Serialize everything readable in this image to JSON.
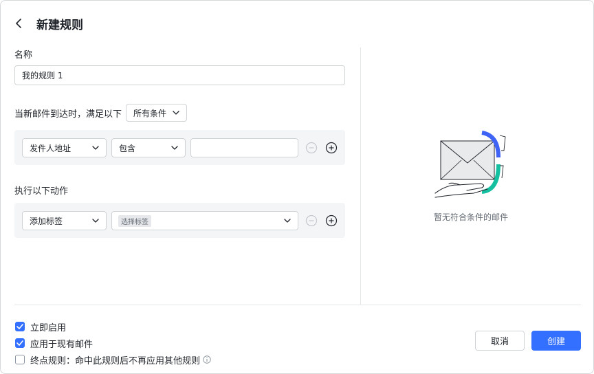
{
  "header": {
    "title": "新建规则"
  },
  "form": {
    "name_label": "名称",
    "name_value": "我的规则 1",
    "condition_prefix": "当新邮件到达时，满足以下",
    "condition_mode": "所有条件",
    "condition_rule": {
      "field": "发件人地址",
      "operator": "包含",
      "value": ""
    },
    "action_label": "执行以下动作",
    "action_rule": {
      "action": "添加标签",
      "tag_placeholder": "选择标签"
    }
  },
  "preview": {
    "empty_text": "暂无符合条件的邮件"
  },
  "options": [
    {
      "label": "立即启用",
      "checked": true
    },
    {
      "label": "应用于现有邮件",
      "checked": true
    },
    {
      "label": "终点规则：命中此规则后不再应用其他规则",
      "checked": false
    }
  ],
  "buttons": {
    "cancel": "取消",
    "create": "创建"
  },
  "colors": {
    "accent": "#3370ff",
    "teal": "#14c0a0",
    "panel_bg": "#f4f5f7"
  }
}
